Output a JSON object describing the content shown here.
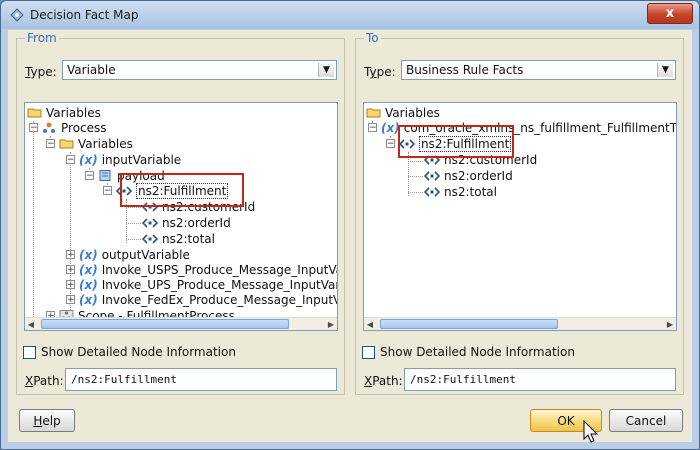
{
  "window": {
    "title": "Decision Fact Map",
    "close_label": "x"
  },
  "from": {
    "title": "From",
    "type_label": "Type:",
    "type_value": "Variable",
    "tree": {
      "variables": "Variables",
      "process": "Process",
      "variables2": "Variables",
      "input_variable": "inputVariable",
      "payload": "payload",
      "fulfillment": "ns2:Fulfillment",
      "customer_id": "ns2:customerId",
      "order_id": "ns2:orderId",
      "total": "ns2:total",
      "output_variable": "outputVariable",
      "usps": "Invoke_USPS_Produce_Message_InputVa",
      "ups": "Invoke_UPS_Produce_Message_InputVar",
      "fedex": "Invoke_FedEx_Produce_Message_InputV",
      "scope": "Scope - FulfillmentProcess"
    },
    "show_detail_label": "Show Detailed Node Information",
    "xpath_label": "XPath:",
    "xpath_value": "/ns2:Fulfillment"
  },
  "to": {
    "title": "To",
    "type_label": "Type:",
    "type_value": "Business Rule Facts",
    "tree": {
      "variables": "Variables",
      "fact_type": "com_oracle_xmlns_ns_fulfillment_FulfillmentTyp",
      "fulfillment": "ns2:Fulfillment",
      "customer_id": "ns2:customerId",
      "order_id": "ns2:orderId",
      "total": "ns2:total"
    },
    "show_detail_label": "Show Detailed Node Information",
    "xpath_label": "XPath:",
    "xpath_value": "/ns2:Fulfillment"
  },
  "buttons": {
    "help": "Help",
    "ok": "OK",
    "cancel": "Cancel"
  },
  "icons": {
    "var_icon": "(x)",
    "elem_icon": "<>"
  },
  "colors": {
    "accent": "#3b6fb6",
    "highlight": "#c0281e"
  }
}
